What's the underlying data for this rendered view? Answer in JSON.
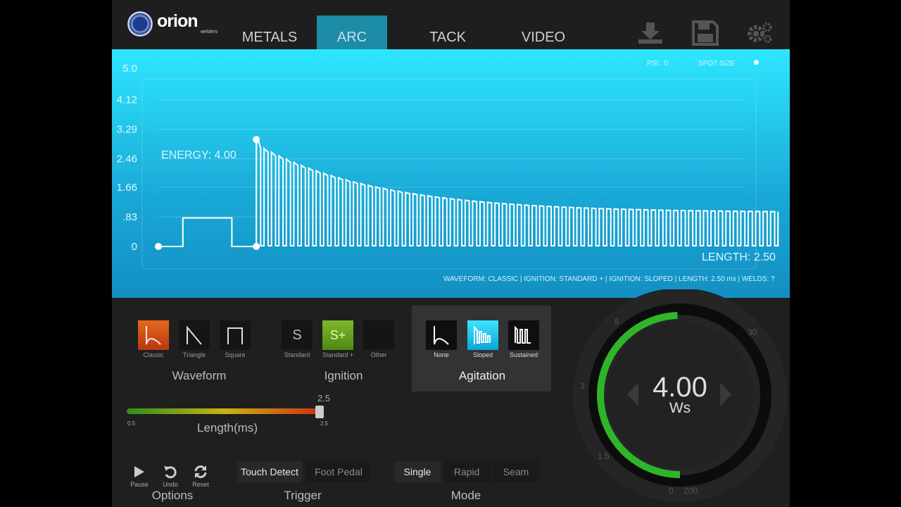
{
  "header": {
    "logo": "orion",
    "logo_sub": "welders",
    "tabs": [
      {
        "label": "METALS"
      },
      {
        "label": "ARC"
      },
      {
        "label": "TACK"
      },
      {
        "label": "VIDEO"
      }
    ],
    "active_tab": "ARC",
    "icons": [
      "download-icon",
      "save-icon",
      "settings-gear-icon"
    ]
  },
  "graph": {
    "psi": "PSI : 0",
    "spot_size": "SPOT SIZE",
    "energy_label": "ENERGY: 4.00",
    "length_label": "LENGTH: 2.50",
    "summary": "WAVEFORM: CLASSIC | IGNITION: STANDARD + | IGNITION: SLOPED | LENGTH: 2.50 ms | WELDS: ?",
    "accent": "#2ee6ff"
  },
  "chart_data": {
    "type": "line",
    "yticks": [
      "5.0",
      "4.12",
      "3.29",
      "2.46",
      "1.66",
      ".83",
      "0"
    ],
    "ylim": [
      0,
      5
    ],
    "ignition_pulse": [
      {
        "x": 0,
        "y": 0
      },
      {
        "x": 0.1,
        "y": 0
      },
      {
        "x": 0.1,
        "y": 0.8
      },
      {
        "x": 0.3,
        "y": 0.8
      },
      {
        "x": 0.3,
        "y": 0
      },
      {
        "x": 0.4,
        "y": 0
      }
    ],
    "peak": {
      "x": 0.4,
      "y": 3.0
    },
    "sloped_decay": {
      "start": 2.75,
      "end": 0.95,
      "pulses": 70
    },
    "xlim": [
      0,
      2.5
    ]
  },
  "waveform": {
    "title": "Waveform",
    "items": [
      {
        "label": "Classic",
        "icon": "classic-wave-icon"
      },
      {
        "label": "Triangle",
        "icon": "triangle-wave-icon"
      },
      {
        "label": "Square",
        "icon": "square-wave-icon"
      }
    ]
  },
  "ignition": {
    "title": "Ignition",
    "items": [
      {
        "label": "Standard",
        "glyph": "S"
      },
      {
        "label": "Standard +",
        "glyph": "S+"
      },
      {
        "label": "Other",
        "glyph": ""
      }
    ]
  },
  "agitation": {
    "title": "Agitation",
    "items": [
      {
        "label": "None",
        "icon": "none-agitation-icon"
      },
      {
        "label": "Sloped",
        "icon": "sloped-agitation-icon"
      },
      {
        "label": "Sustained",
        "icon": "sustained-agitation-icon"
      }
    ]
  },
  "length": {
    "title": "Length(ms)",
    "min": "0.5",
    "max": "2.5",
    "value": "2.5",
    "fraction": 1.0
  },
  "options": {
    "title": "Options",
    "items": [
      {
        "label": "Pause"
      },
      {
        "label": "Undo"
      },
      {
        "label": "Reset"
      }
    ]
  },
  "trigger": {
    "title": "Trigger",
    "items": [
      {
        "label": "Touch Detect"
      },
      {
        "label": "Foot Pedal"
      }
    ],
    "selected": "Touch Detect"
  },
  "mode": {
    "title": "Mode",
    "items": [
      {
        "label": "Single"
      },
      {
        "label": "Rapid"
      },
      {
        "label": "Seam"
      }
    ],
    "selected": "Single"
  },
  "dial": {
    "value": "4.00",
    "unit": "Ws",
    "ticks": [
      "5",
      "30",
      "3",
      "1.5",
      "0",
      "200"
    ],
    "fraction": 0.3,
    "arc_color": "#2fb52a"
  }
}
